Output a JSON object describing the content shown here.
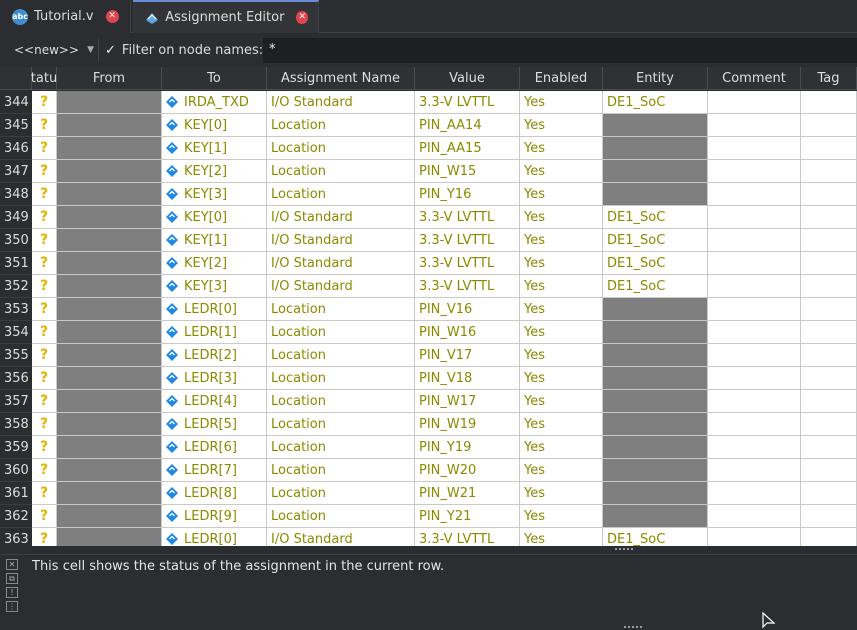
{
  "tabs": [
    {
      "label": "Tutorial.v",
      "icon": "verilog-file-icon"
    },
    {
      "label": "Assignment Editor",
      "icon": "assignment-editor-icon"
    }
  ],
  "filter": {
    "dropdown_value": "<<new>>",
    "checkbox": "✓",
    "label": "Filter on node names:",
    "value": "*"
  },
  "columns": [
    "tatu",
    "From",
    "To",
    "Assignment Name",
    "Value",
    "Enabled",
    "Entity",
    "Comment",
    "Tag"
  ],
  "rows": [
    {
      "n": "344",
      "status": "?",
      "to": "IRDA_TXD",
      "name": "I/O Standard",
      "value": "3.3-V LVTTL",
      "enabled": "Yes",
      "entity": "DE1_SoC"
    },
    {
      "n": "345",
      "status": "?",
      "to": "KEY[0]",
      "name": "Location",
      "value": "PIN_AA14",
      "enabled": "Yes",
      "entity": ""
    },
    {
      "n": "346",
      "status": "?",
      "to": "KEY[1]",
      "name": "Location",
      "value": "PIN_AA15",
      "enabled": "Yes",
      "entity": ""
    },
    {
      "n": "347",
      "status": "?",
      "to": "KEY[2]",
      "name": "Location",
      "value": "PIN_W15",
      "enabled": "Yes",
      "entity": ""
    },
    {
      "n": "348",
      "status": "?",
      "to": "KEY[3]",
      "name": "Location",
      "value": "PIN_Y16",
      "enabled": "Yes",
      "entity": ""
    },
    {
      "n": "349",
      "status": "?",
      "to": "KEY[0]",
      "name": "I/O Standard",
      "value": "3.3-V LVTTL",
      "enabled": "Yes",
      "entity": "DE1_SoC"
    },
    {
      "n": "350",
      "status": "?",
      "to": "KEY[1]",
      "name": "I/O Standard",
      "value": "3.3-V LVTTL",
      "enabled": "Yes",
      "entity": "DE1_SoC"
    },
    {
      "n": "351",
      "status": "?",
      "to": "KEY[2]",
      "name": "I/O Standard",
      "value": "3.3-V LVTTL",
      "enabled": "Yes",
      "entity": "DE1_SoC"
    },
    {
      "n": "352",
      "status": "?",
      "to": "KEY[3]",
      "name": "I/O Standard",
      "value": "3.3-V LVTTL",
      "enabled": "Yes",
      "entity": "DE1_SoC"
    },
    {
      "n": "353",
      "status": "?",
      "to": "LEDR[0]",
      "name": "Location",
      "value": "PIN_V16",
      "enabled": "Yes",
      "entity": ""
    },
    {
      "n": "354",
      "status": "?",
      "to": "LEDR[1]",
      "name": "Location",
      "value": "PIN_W16",
      "enabled": "Yes",
      "entity": ""
    },
    {
      "n": "355",
      "status": "?",
      "to": "LEDR[2]",
      "name": "Location",
      "value": "PIN_V17",
      "enabled": "Yes",
      "entity": ""
    },
    {
      "n": "356",
      "status": "?",
      "to": "LEDR[3]",
      "name": "Location",
      "value": "PIN_V18",
      "enabled": "Yes",
      "entity": ""
    },
    {
      "n": "357",
      "status": "?",
      "to": "LEDR[4]",
      "name": "Location",
      "value": "PIN_W17",
      "enabled": "Yes",
      "entity": ""
    },
    {
      "n": "358",
      "status": "?",
      "to": "LEDR[5]",
      "name": "Location",
      "value": "PIN_W19",
      "enabled": "Yes",
      "entity": ""
    },
    {
      "n": "359",
      "status": "?",
      "to": "LEDR[6]",
      "name": "Location",
      "value": "PIN_Y19",
      "enabled": "Yes",
      "entity": ""
    },
    {
      "n": "360",
      "status": "?",
      "to": "LEDR[7]",
      "name": "Location",
      "value": "PIN_W20",
      "enabled": "Yes",
      "entity": ""
    },
    {
      "n": "361",
      "status": "?",
      "to": "LEDR[8]",
      "name": "Location",
      "value": "PIN_W21",
      "enabled": "Yes",
      "entity": ""
    },
    {
      "n": "362",
      "status": "?",
      "to": "LEDR[9]",
      "name": "Location",
      "value": "PIN_Y21",
      "enabled": "Yes",
      "entity": ""
    },
    {
      "n": "363",
      "status": "?",
      "to": "LEDR[0]",
      "name": "I/O Standard",
      "value": "3.3-V LVTTL",
      "enabled": "Yes",
      "entity": "DE1_SoC"
    }
  ],
  "status_message": "This cell shows the status of the assignment in the current row.",
  "colors": {
    "text_value": "#8a8a00",
    "status_question": "#e3b400",
    "node_icon": "#1e88e5",
    "close_icon": "#e0444d"
  }
}
